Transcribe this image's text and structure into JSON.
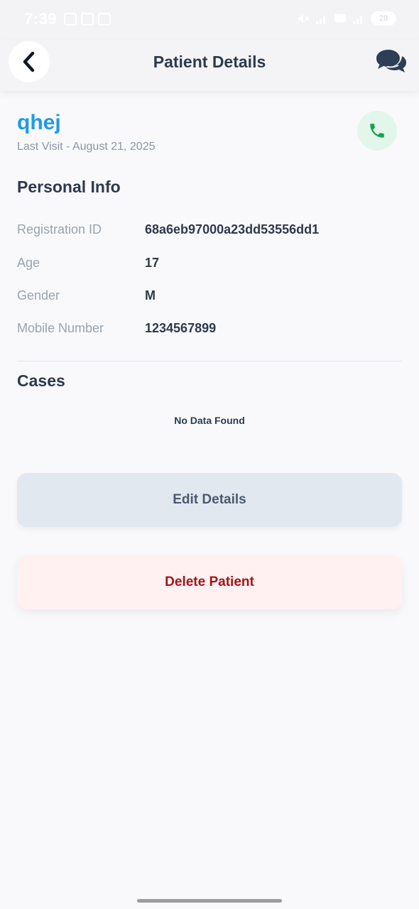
{
  "status_bar": {
    "time": "7:39",
    "battery": "28"
  },
  "header": {
    "title": "Patient Details",
    "back_icon": "chevron-left-icon",
    "chat_icon": "chat-bubbles-icon"
  },
  "patient": {
    "name": "qhej",
    "last_visit": "Last Visit - August 21, 2025",
    "call_icon": "phone-icon"
  },
  "personal_info": {
    "title": "Personal Info",
    "rows": [
      {
        "label": "Registration ID",
        "value": "68a6eb97000a23dd53556dd1"
      },
      {
        "label": "Age",
        "value": "17"
      },
      {
        "label": "Gender",
        "value": "M"
      },
      {
        "label": "Mobile Number",
        "value": "1234567899"
      }
    ]
  },
  "cases": {
    "title": "Cases",
    "empty_text": "No Data Found"
  },
  "actions": {
    "edit_label": "Edit Details",
    "delete_label": "Delete Patient"
  },
  "colors": {
    "accent": "#1e9be3",
    "call_green": "#16a34a",
    "delete_red": "#a1151b",
    "edit_bg": "#e2e8f0",
    "delete_bg": "#fff1f1"
  }
}
